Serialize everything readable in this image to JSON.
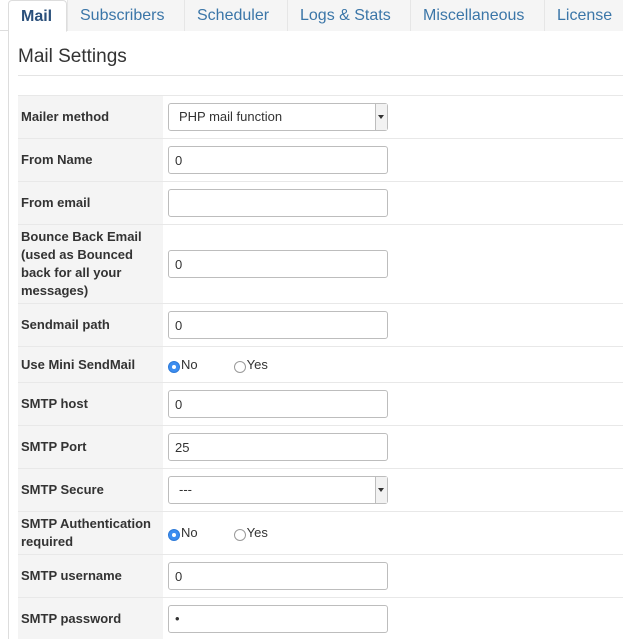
{
  "tabs": [
    {
      "label": "Mail",
      "active": true
    },
    {
      "label": "Subscribers",
      "active": false
    },
    {
      "label": "Scheduler",
      "active": false
    },
    {
      "label": "Logs & Stats",
      "active": false
    },
    {
      "label": "Miscellaneous",
      "active": false
    },
    {
      "label": "License",
      "active": false
    }
  ],
  "section": {
    "title": "Mail Settings"
  },
  "fields": {
    "mailer_method": {
      "label": "Mailer method",
      "value": "PHP mail function"
    },
    "from_name": {
      "label": "From Name",
      "value": "0"
    },
    "from_email": {
      "label": "From email",
      "value": ""
    },
    "bounce_back_email": {
      "label": "Bounce Back Email (used as Bounced back for all your messages)",
      "value": "0"
    },
    "sendmail_path": {
      "label": "Sendmail path",
      "value": "0"
    },
    "use_mini_sendmail": {
      "label": "Use Mini SendMail",
      "options": [
        "No",
        "Yes"
      ],
      "selected": "No"
    },
    "smtp_host": {
      "label": "SMTP host",
      "value": "0"
    },
    "smtp_port": {
      "label": "SMTP Port",
      "value": "25"
    },
    "smtp_secure": {
      "label": "SMTP Secure",
      "value": "---"
    },
    "smtp_auth": {
      "label": "SMTP Authentication required",
      "options": [
        "No",
        "Yes"
      ],
      "selected": "No"
    },
    "smtp_username": {
      "label": "SMTP username",
      "value": "0"
    },
    "smtp_password": {
      "label": "SMTP password",
      "value": "•"
    }
  },
  "colors": {
    "tab_text": "#3b76a8",
    "active_tab_text": "#2a4f7a",
    "radio_checked": "#3c8df0",
    "label_background": "#f4f4f4"
  }
}
